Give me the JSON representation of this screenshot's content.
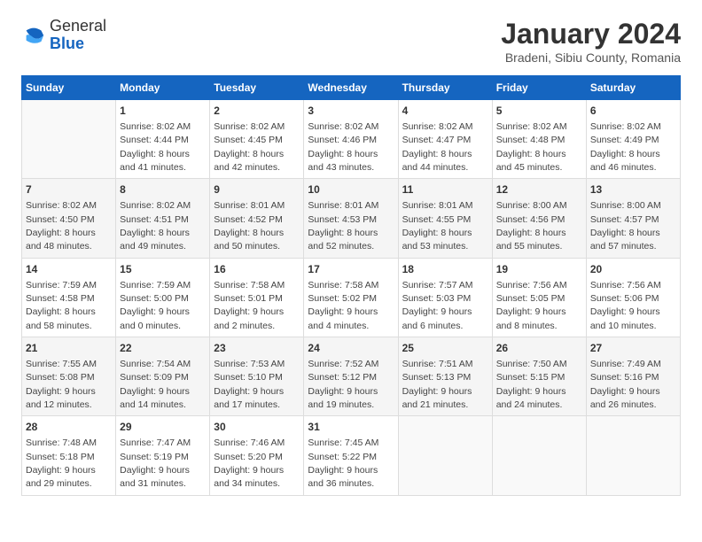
{
  "logo": {
    "general": "General",
    "blue": "Blue"
  },
  "header": {
    "month": "January 2024",
    "location": "Bradeni, Sibiu County, Romania"
  },
  "weekdays": [
    "Sunday",
    "Monday",
    "Tuesday",
    "Wednesday",
    "Thursday",
    "Friday",
    "Saturday"
  ],
  "weeks": [
    [
      {
        "day": "",
        "sunrise": "",
        "sunset": "",
        "daylight": ""
      },
      {
        "day": "1",
        "sunrise": "Sunrise: 8:02 AM",
        "sunset": "Sunset: 4:44 PM",
        "daylight": "Daylight: 8 hours and 41 minutes."
      },
      {
        "day": "2",
        "sunrise": "Sunrise: 8:02 AM",
        "sunset": "Sunset: 4:45 PM",
        "daylight": "Daylight: 8 hours and 42 minutes."
      },
      {
        "day": "3",
        "sunrise": "Sunrise: 8:02 AM",
        "sunset": "Sunset: 4:46 PM",
        "daylight": "Daylight: 8 hours and 43 minutes."
      },
      {
        "day": "4",
        "sunrise": "Sunrise: 8:02 AM",
        "sunset": "Sunset: 4:47 PM",
        "daylight": "Daylight: 8 hours and 44 minutes."
      },
      {
        "day": "5",
        "sunrise": "Sunrise: 8:02 AM",
        "sunset": "Sunset: 4:48 PM",
        "daylight": "Daylight: 8 hours and 45 minutes."
      },
      {
        "day": "6",
        "sunrise": "Sunrise: 8:02 AM",
        "sunset": "Sunset: 4:49 PM",
        "daylight": "Daylight: 8 hours and 46 minutes."
      }
    ],
    [
      {
        "day": "7",
        "sunrise": "Sunrise: 8:02 AM",
        "sunset": "Sunset: 4:50 PM",
        "daylight": "Daylight: 8 hours and 48 minutes."
      },
      {
        "day": "8",
        "sunrise": "Sunrise: 8:02 AM",
        "sunset": "Sunset: 4:51 PM",
        "daylight": "Daylight: 8 hours and 49 minutes."
      },
      {
        "day": "9",
        "sunrise": "Sunrise: 8:01 AM",
        "sunset": "Sunset: 4:52 PM",
        "daylight": "Daylight: 8 hours and 50 minutes."
      },
      {
        "day": "10",
        "sunrise": "Sunrise: 8:01 AM",
        "sunset": "Sunset: 4:53 PM",
        "daylight": "Daylight: 8 hours and 52 minutes."
      },
      {
        "day": "11",
        "sunrise": "Sunrise: 8:01 AM",
        "sunset": "Sunset: 4:55 PM",
        "daylight": "Daylight: 8 hours and 53 minutes."
      },
      {
        "day": "12",
        "sunrise": "Sunrise: 8:00 AM",
        "sunset": "Sunset: 4:56 PM",
        "daylight": "Daylight: 8 hours and 55 minutes."
      },
      {
        "day": "13",
        "sunrise": "Sunrise: 8:00 AM",
        "sunset": "Sunset: 4:57 PM",
        "daylight": "Daylight: 8 hours and 57 minutes."
      }
    ],
    [
      {
        "day": "14",
        "sunrise": "Sunrise: 7:59 AM",
        "sunset": "Sunset: 4:58 PM",
        "daylight": "Daylight: 8 hours and 58 minutes."
      },
      {
        "day": "15",
        "sunrise": "Sunrise: 7:59 AM",
        "sunset": "Sunset: 5:00 PM",
        "daylight": "Daylight: 9 hours and 0 minutes."
      },
      {
        "day": "16",
        "sunrise": "Sunrise: 7:58 AM",
        "sunset": "Sunset: 5:01 PM",
        "daylight": "Daylight: 9 hours and 2 minutes."
      },
      {
        "day": "17",
        "sunrise": "Sunrise: 7:58 AM",
        "sunset": "Sunset: 5:02 PM",
        "daylight": "Daylight: 9 hours and 4 minutes."
      },
      {
        "day": "18",
        "sunrise": "Sunrise: 7:57 AM",
        "sunset": "Sunset: 5:03 PM",
        "daylight": "Daylight: 9 hours and 6 minutes."
      },
      {
        "day": "19",
        "sunrise": "Sunrise: 7:56 AM",
        "sunset": "Sunset: 5:05 PM",
        "daylight": "Daylight: 9 hours and 8 minutes."
      },
      {
        "day": "20",
        "sunrise": "Sunrise: 7:56 AM",
        "sunset": "Sunset: 5:06 PM",
        "daylight": "Daylight: 9 hours and 10 minutes."
      }
    ],
    [
      {
        "day": "21",
        "sunrise": "Sunrise: 7:55 AM",
        "sunset": "Sunset: 5:08 PM",
        "daylight": "Daylight: 9 hours and 12 minutes."
      },
      {
        "day": "22",
        "sunrise": "Sunrise: 7:54 AM",
        "sunset": "Sunset: 5:09 PM",
        "daylight": "Daylight: 9 hours and 14 minutes."
      },
      {
        "day": "23",
        "sunrise": "Sunrise: 7:53 AM",
        "sunset": "Sunset: 5:10 PM",
        "daylight": "Daylight: 9 hours and 17 minutes."
      },
      {
        "day": "24",
        "sunrise": "Sunrise: 7:52 AM",
        "sunset": "Sunset: 5:12 PM",
        "daylight": "Daylight: 9 hours and 19 minutes."
      },
      {
        "day": "25",
        "sunrise": "Sunrise: 7:51 AM",
        "sunset": "Sunset: 5:13 PM",
        "daylight": "Daylight: 9 hours and 21 minutes."
      },
      {
        "day": "26",
        "sunrise": "Sunrise: 7:50 AM",
        "sunset": "Sunset: 5:15 PM",
        "daylight": "Daylight: 9 hours and 24 minutes."
      },
      {
        "day": "27",
        "sunrise": "Sunrise: 7:49 AM",
        "sunset": "Sunset: 5:16 PM",
        "daylight": "Daylight: 9 hours and 26 minutes."
      }
    ],
    [
      {
        "day": "28",
        "sunrise": "Sunrise: 7:48 AM",
        "sunset": "Sunset: 5:18 PM",
        "daylight": "Daylight: 9 hours and 29 minutes."
      },
      {
        "day": "29",
        "sunrise": "Sunrise: 7:47 AM",
        "sunset": "Sunset: 5:19 PM",
        "daylight": "Daylight: 9 hours and 31 minutes."
      },
      {
        "day": "30",
        "sunrise": "Sunrise: 7:46 AM",
        "sunset": "Sunset: 5:20 PM",
        "daylight": "Daylight: 9 hours and 34 minutes."
      },
      {
        "day": "31",
        "sunrise": "Sunrise: 7:45 AM",
        "sunset": "Sunset: 5:22 PM",
        "daylight": "Daylight: 9 hours and 36 minutes."
      },
      {
        "day": "",
        "sunrise": "",
        "sunset": "",
        "daylight": ""
      },
      {
        "day": "",
        "sunrise": "",
        "sunset": "",
        "daylight": ""
      },
      {
        "day": "",
        "sunrise": "",
        "sunset": "",
        "daylight": ""
      }
    ]
  ]
}
